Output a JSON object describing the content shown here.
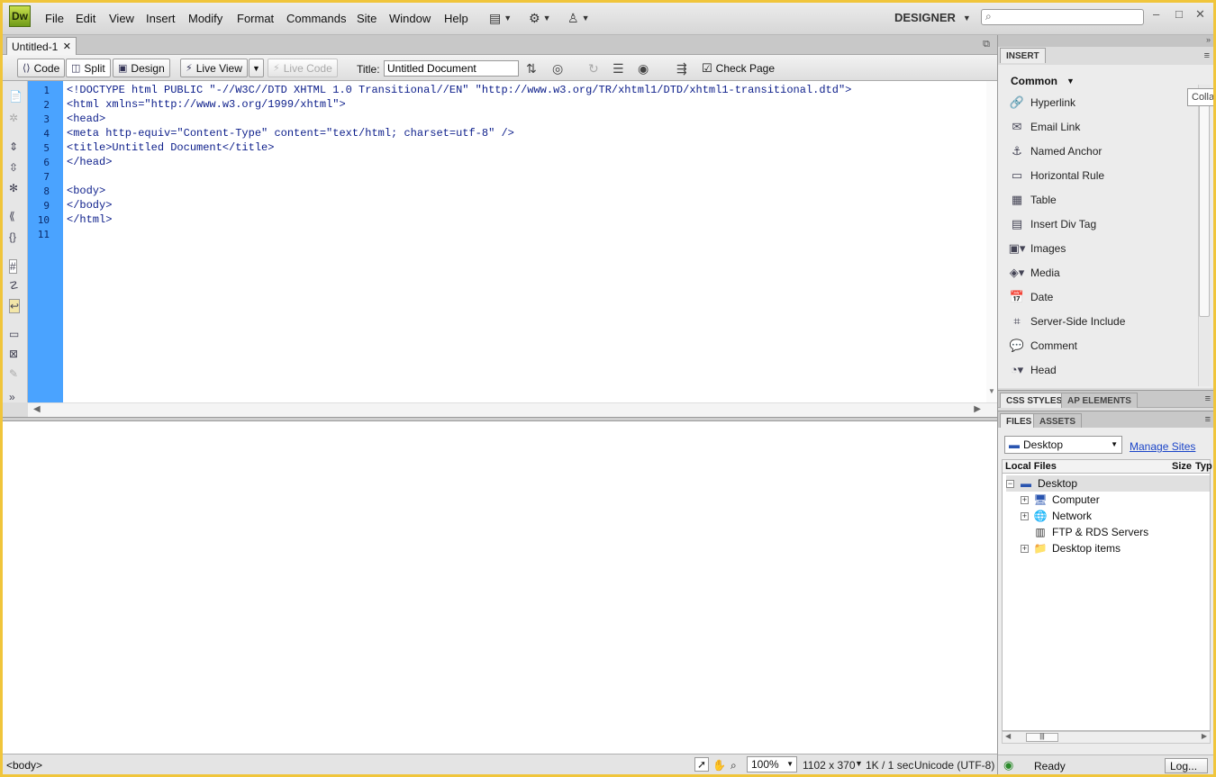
{
  "app": {
    "logo": "Dw",
    "menus": [
      "File",
      "Edit",
      "View",
      "Insert",
      "Modify",
      "Format",
      "Commands",
      "Site",
      "Window",
      "Help"
    ],
    "workspace": "DESIGNER",
    "search_placeholder": ""
  },
  "document": {
    "tab_name": "Untitled-1",
    "toolbar": {
      "code": "Code",
      "split": "Split",
      "design": "Design",
      "live_view": "Live View",
      "live_code": "Live Code",
      "title_label": "Title:",
      "title_value": "Untitled Document",
      "check_page": "Check Page"
    },
    "line_numbers": [
      "1",
      "2",
      "3",
      "4",
      "5",
      "6",
      "7",
      "8",
      "9",
      "10",
      "11"
    ],
    "code_lines": [
      "<!DOCTYPE html PUBLIC \"-//W3C//DTD XHTML 1.0 Transitional//EN\" \"http://www.w3.org/TR/xhtml1/DTD/xhtml1-transitional.dtd\">",
      "<html xmlns=\"http://www.w3.org/1999/xhtml\">",
      "<head>",
      "<meta http-equiv=\"Content-Type\" content=\"text/html; charset=utf-8\" />",
      "<title>Untitled Document</title>",
      "</head>",
      "",
      "<body>",
      "</body>",
      "</html>",
      ""
    ]
  },
  "status": {
    "tag": "<body>",
    "zoom": "100%",
    "dimensions": "1102 x 370",
    "download": "1K / 1 sec",
    "encoding": "Unicode (UTF-8)"
  },
  "insert_panel": {
    "tab": "INSERT",
    "category": "Common",
    "tooltip": "Colla",
    "items": [
      "Hyperlink",
      "Email Link",
      "Named Anchor",
      "Horizontal Rule",
      "Table",
      "Insert Div Tag",
      "Images",
      "Media",
      "Date",
      "Server-Side Include",
      "Comment",
      "Head"
    ]
  },
  "css_panel": {
    "tab1": "CSS STYLES",
    "tab2": "AP ELEMENTS"
  },
  "files_panel": {
    "tab1": "FILES",
    "tab2": "ASSETS",
    "site": "Desktop",
    "manage_sites": "Manage Sites",
    "col_local": "Local Files",
    "col_size": "Size",
    "col_type": "Typ",
    "tree": [
      "Desktop",
      "Computer",
      "Network",
      "FTP & RDS Servers",
      "Desktop items"
    ],
    "status": "Ready",
    "log_button": "Log..."
  }
}
